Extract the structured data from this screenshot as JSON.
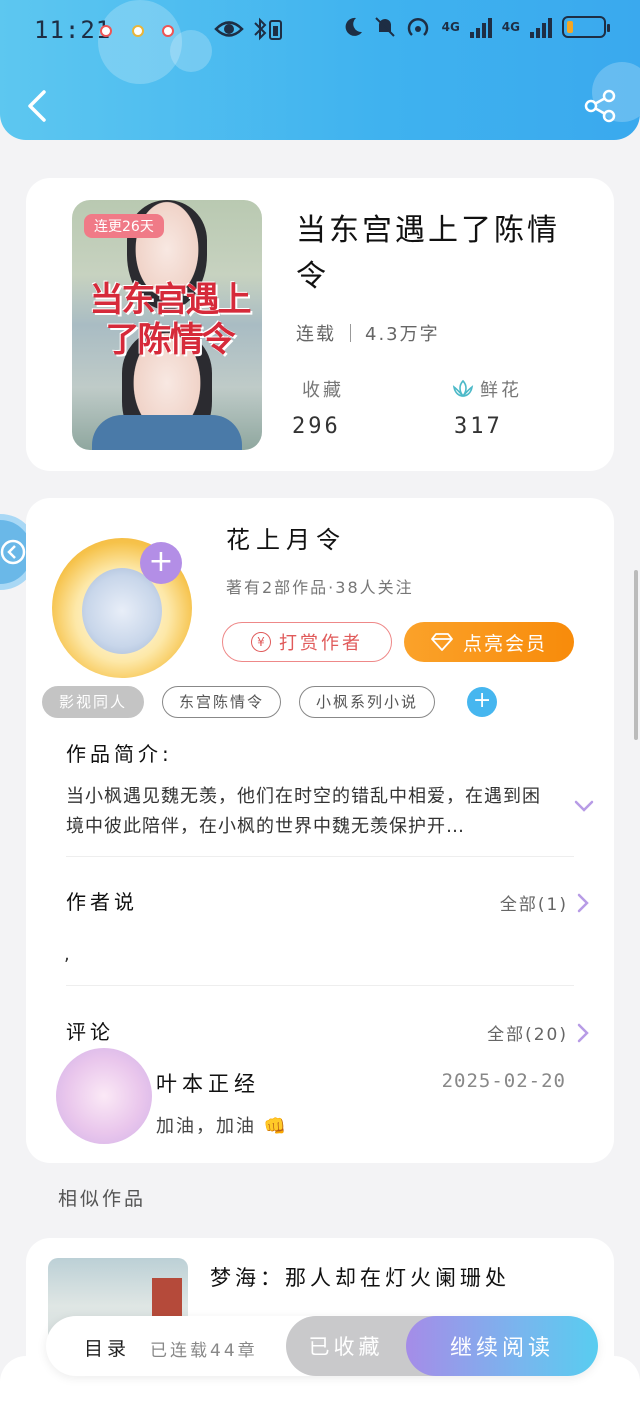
{
  "status_bar": {
    "time": "11:21",
    "network": [
      "4G",
      "4G"
    ]
  },
  "nav": {
    "back_icon": "chevron-left-icon",
    "share_icon": "share-icon"
  },
  "book": {
    "streak_badge": "连更26天",
    "cover_title": "当东宫遇上了陈情令",
    "title": "当东宫遇上了陈情令",
    "status": "连载",
    "word_count": "4.3万字",
    "favorites_label": "收藏",
    "favorites_value": "296",
    "flowers_label": "鲜花",
    "flowers_value": "317"
  },
  "author": {
    "name": "花上月令",
    "info": "著有2部作品·38人关注",
    "tip_label": "打赏作者",
    "vip_label": "点亮会员"
  },
  "tags": [
    "影视同人",
    "东宫陈情令",
    "小枫系列小说"
  ],
  "synopsis": {
    "title": "作品简介:",
    "text": "当小枫遇见魏无羡，他们在时空的错乱中相爱，在遇到困境中彼此陪伴，在小枫的世界中魏无羡保护开…"
  },
  "author_says": {
    "title": "作者说",
    "more": "全部(1)",
    "text": ","
  },
  "comments": {
    "title": "评论",
    "more": "全部(20)",
    "items": [
      {
        "user": "叶本正经",
        "date": "2025-02-20",
        "text": "加油，加油 👊"
      }
    ]
  },
  "similar": {
    "label": "相似作品",
    "items": [
      {
        "title": "梦海：那人却在灯火阑珊处"
      }
    ]
  },
  "bottom_bar": {
    "toc": "目录",
    "chapters": "已连载44章",
    "favorited": "已收藏",
    "continue": "继续阅读"
  },
  "colors": {
    "header": "#3fb2ef",
    "vip": "#f98f10",
    "tip": "#e05a5a",
    "read_gradient_start": "#a58ce8",
    "read_gradient_end": "#58cdf0"
  }
}
